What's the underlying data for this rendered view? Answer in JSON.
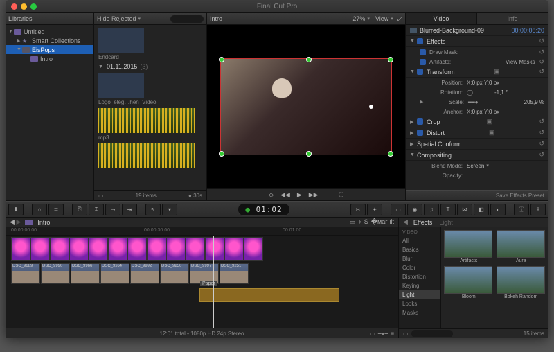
{
  "app": {
    "title": "Final Cut Pro"
  },
  "libraries": {
    "heading": "Libraries",
    "items": [
      {
        "label": "Untitled",
        "indent": 0,
        "selected": false,
        "expanded": true,
        "icon": "project"
      },
      {
        "label": "Smart Collections",
        "indent": 1,
        "selected": false,
        "icon": "star"
      },
      {
        "label": "EisPops",
        "indent": 1,
        "selected": true,
        "icon": "event"
      },
      {
        "label": "Intro",
        "indent": 2,
        "selected": false,
        "icon": "project"
      }
    ]
  },
  "browser": {
    "filter_label": "Hide Rejected",
    "date_group": "01.11.2015",
    "date_count": "(3)",
    "clips": [
      {
        "label": "Endcard",
        "kind": "video"
      },
      {
        "label": "Logo_eleg…hen_Video",
        "kind": "video"
      },
      {
        "label": "mp3",
        "kind": "audio"
      }
    ],
    "footer_count": "19 items",
    "duration_label": "30s"
  },
  "viewer": {
    "title": "Intro",
    "zoom": "27%",
    "view_label": "View"
  },
  "inspector": {
    "tabs": [
      "Video",
      "Info"
    ],
    "active_tab": "Video",
    "clip_name": "Blurred-Background-09",
    "clip_time": "00:00:08:20",
    "sections": {
      "effects": "Effects",
      "draw_mask": "Draw Mask:",
      "artifacts": "Artifacts:",
      "artifacts_action": "View Masks",
      "transform": "Transform",
      "position": "Position:",
      "pos_x_lbl": "X:",
      "pos_x": "0 px",
      "pos_y_lbl": "Y:",
      "pos_y": "0 px",
      "rotation": "Rotation:",
      "rotation_val": "-1,1 °",
      "scale": "Scale:",
      "scale_val": "205,9 %",
      "anchor": "Anchor:",
      "anc_x_lbl": "X:",
      "anc_x": "0 px",
      "anc_y_lbl": "Y:",
      "anc_y": "0 px",
      "crop": "Crop",
      "distort": "Distort",
      "spatial": "Spatial Conform",
      "compositing": "Compositing",
      "blend_mode": "Blend Mode:",
      "blend_val": "Screen",
      "opacity": "Opacity:"
    },
    "footer": "Save Effects Preset"
  },
  "timeline": {
    "project": "Intro",
    "timecode": "01:02",
    "ruler": [
      "00:00:00:00",
      "00:00:30:00",
      "00:01:00"
    ],
    "connected_clips": [
      "DSC_9689",
      "DSC_9990",
      "DSC_9966",
      "DSC_9x64",
      "DSC_9992",
      "DSC_9250",
      "DSC_9997",
      "DSC_9251"
    ],
    "audio_clip": "Paper",
    "footer": "12:01 total • 1080p HD 24p Stereo"
  },
  "effects": {
    "tabs": [
      "Effects",
      "Light"
    ],
    "categories_heading": "VIDEO",
    "categories": [
      "All",
      "Basics",
      "Blur",
      "Color",
      "Distortion",
      "Keying",
      "Light",
      "Looks",
      "Masks"
    ],
    "selected_category": "Light",
    "items": [
      "Artifacts",
      "Aura",
      "Bloom",
      "Bokeh Random"
    ],
    "footer_count": "15 items"
  }
}
